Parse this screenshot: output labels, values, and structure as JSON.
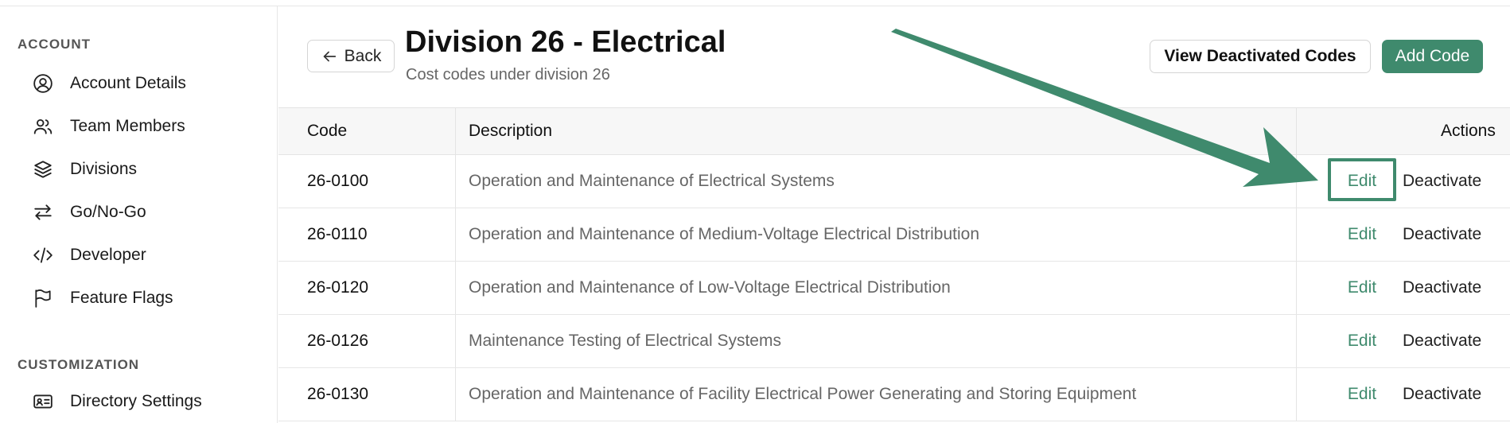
{
  "sidebar": {
    "sections": [
      {
        "label": "ACCOUNT",
        "items": [
          {
            "label": "Account Details",
            "icon": "user-circle-icon"
          },
          {
            "label": "Team Members",
            "icon": "users-icon"
          },
          {
            "label": "Divisions",
            "icon": "layers-icon"
          },
          {
            "label": "Go/No-Go",
            "icon": "swap-arrows-icon"
          },
          {
            "label": "Developer",
            "icon": "code-icon"
          },
          {
            "label": "Feature Flags",
            "icon": "flag-icon"
          }
        ]
      },
      {
        "label": "CUSTOMIZATION",
        "items": [
          {
            "label": "Directory Settings",
            "icon": "id-card-icon"
          }
        ]
      }
    ]
  },
  "header": {
    "back_label": "Back",
    "title": "Division 26 - Electrical",
    "subtitle": "Cost codes under division 26",
    "view_deactivated_label": "View Deactivated Codes",
    "add_code_label": "Add Code"
  },
  "table": {
    "columns": {
      "code": "Code",
      "description": "Description",
      "actions": "Actions"
    },
    "rows": [
      {
        "code": "26-0100",
        "description": "Operation and Maintenance of Electrical Systems",
        "edit": "Edit",
        "deactivate": "Deactivate"
      },
      {
        "code": "26-0110",
        "description": "Operation and Maintenance of Medium-Voltage Electrical Distribution",
        "edit": "Edit",
        "deactivate": "Deactivate"
      },
      {
        "code": "26-0120",
        "description": "Operation and Maintenance of Low-Voltage Electrical Distribution",
        "edit": "Edit",
        "deactivate": "Deactivate"
      },
      {
        "code": "26-0126",
        "description": "Maintenance Testing of Electrical Systems",
        "edit": "Edit",
        "deactivate": "Deactivate"
      },
      {
        "code": "26-0130",
        "description": "Operation and Maintenance of Facility Electrical Power Generating and Storing Equipment",
        "edit": "Edit",
        "deactivate": "Deactivate"
      }
    ]
  },
  "colors": {
    "accent": "#3f8a6d",
    "muted_text": "#666666",
    "border": "#e4e4e4"
  }
}
